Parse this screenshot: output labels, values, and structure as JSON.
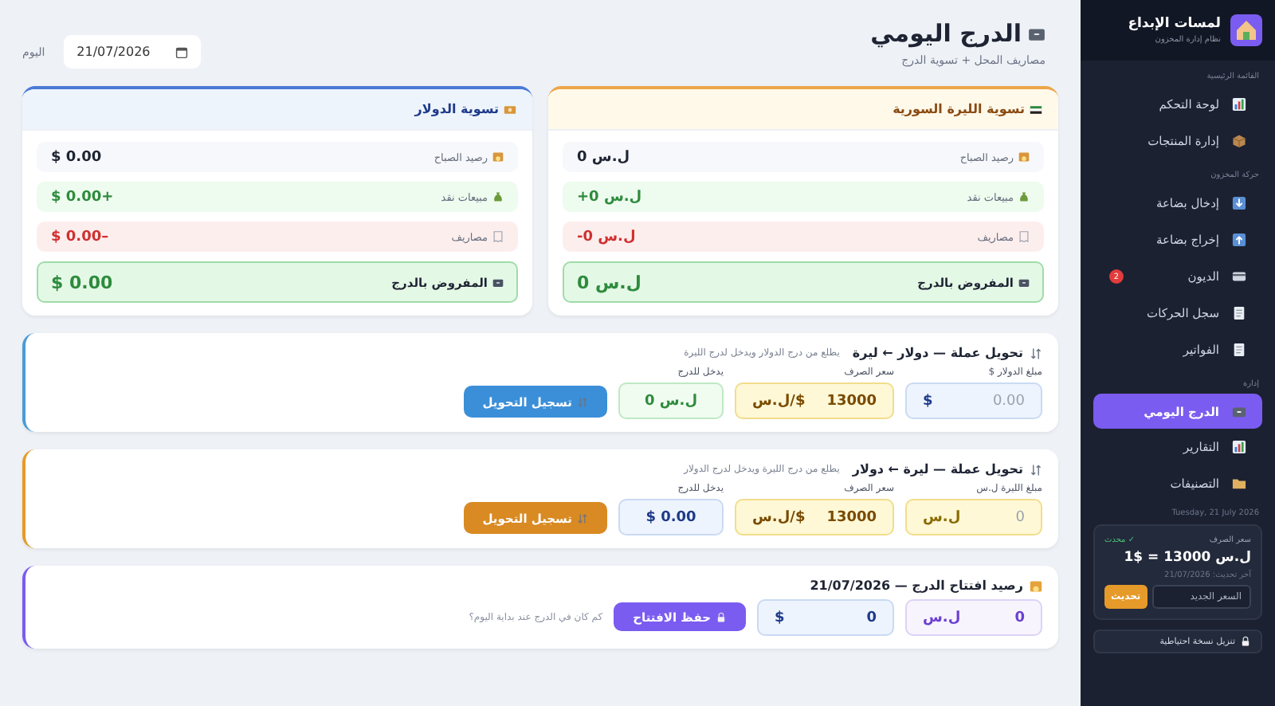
{
  "header": {
    "title": "الدرج اليومي",
    "subtitle": "مصاريف المحل + تسوية الدرج",
    "date_label": "اليوم",
    "date_value": "21/07/2026"
  },
  "settlements": [
    {
      "kind": "syp",
      "title": "تسوية الليرة السورية",
      "rows": [
        {
          "kind": "opening",
          "label": "رصيد الصباح",
          "value": "0 ل.س"
        },
        {
          "kind": "sales",
          "label": "مبيعات نقد",
          "value": "+0 ل.س"
        },
        {
          "kind": "expenses",
          "label": "مصاريف",
          "value": "-0 ل.س"
        },
        {
          "kind": "total",
          "label": "المفروض بالدرج",
          "value": "0 ل.س"
        }
      ]
    },
    {
      "kind": "usd",
      "title": "تسوية الدولار",
      "rows": [
        {
          "kind": "opening",
          "label": "رصيد الصباح",
          "value": "$ 0.00"
        },
        {
          "kind": "sales",
          "label": "مبيعات نقد",
          "value": "$ 0.00+"
        },
        {
          "kind": "expenses",
          "label": "مصاريف",
          "value": "$ 0.00–"
        },
        {
          "kind": "total",
          "label": "المفروض بالدرج",
          "value": "$ 0.00"
        }
      ]
    }
  ],
  "conversions": [
    {
      "kind": "usd_to_syp",
      "title": "تحويل عملة — دولار ← ليرة",
      "note": "يطلع من درج الدولار ويدخل لدرج الليرة",
      "fields": [
        {
          "kind": "amount",
          "label": "مبلغ الدولار $",
          "unit": "$",
          "placeholder": "0.00"
        },
        {
          "kind": "rate",
          "label": "سعر الصرف",
          "unit": "ل.س/$",
          "value": "13000"
        },
        {
          "kind": "result",
          "label": "يدخل للدرج",
          "value": "0 ل.س"
        }
      ],
      "button": "تسجيل التحويل"
    },
    {
      "kind": "syp_to_usd",
      "title": "تحويل عملة — ليرة ← دولار",
      "note": "يطلع من درج الليرة ويدخل لدرج الدولار",
      "fields": [
        {
          "kind": "amount",
          "label": "مبلغ الليرة ل.س",
          "unit": "ل.س",
          "placeholder": "0"
        },
        {
          "kind": "rate",
          "label": "سعر الصرف",
          "unit": "ل.س/$",
          "value": "13000"
        },
        {
          "kind": "result",
          "label": "يدخل للدرج",
          "value": "$ 0.00"
        }
      ],
      "button": "تسجيل التحويل"
    }
  ],
  "opening": {
    "title": "رصيد افتتاح الدرج — 21/07/2026",
    "fields": [
      {
        "kind": "syp",
        "unit": "ل.س",
        "value": "0"
      },
      {
        "kind": "usd",
        "unit": "$",
        "value": "0"
      }
    ],
    "button": "حفظ الافتتاح",
    "hint": "كم كان في الدرج عند بداية اليوم؟"
  },
  "sidebar": {
    "brand": "لمسات الإبداع",
    "tagline": "نظام إدارة المخزون",
    "sections": [
      {
        "title": "القائمة الرئيسية",
        "items": [
          {
            "kind": "chart",
            "label": "لوحة التحكم",
            "selected": false
          },
          {
            "kind": "box",
            "label": "إدارة المنتجات",
            "selected": false
          }
        ]
      },
      {
        "title": "حركة المخزون",
        "items": [
          {
            "kind": "in",
            "label": "إدخال بضاعة",
            "selected": false
          },
          {
            "kind": "out",
            "label": "إخراج بضاعة",
            "selected": false
          },
          {
            "kind": "card",
            "label": "الديون",
            "badge": "2",
            "selected": false
          },
          {
            "kind": "doc",
            "label": "سجل الحركات",
            "selected": false
          },
          {
            "kind": "doc",
            "label": "الفواتير",
            "selected": false
          }
        ]
      },
      {
        "title": "إدارة",
        "items": [
          {
            "kind": "drawer",
            "label": "الدرج اليومي",
            "selected": true
          },
          {
            "kind": "chart",
            "label": "التقارير",
            "selected": false
          },
          {
            "kind": "folder",
            "label": "التصنيفات",
            "selected": false
          }
        ]
      }
    ],
    "today": "Tuesday, 21 July 2026",
    "rate": {
      "title": "سعر الصرف",
      "status": "✓ محدث",
      "value": "1$ = 13000 ل.س",
      "updated": "آخر تحديث: 21/07/2026",
      "placeholder": "السعر الجديد",
      "button": "تحديث"
    },
    "backup": "تنزيل نسخة احتياطية"
  }
}
